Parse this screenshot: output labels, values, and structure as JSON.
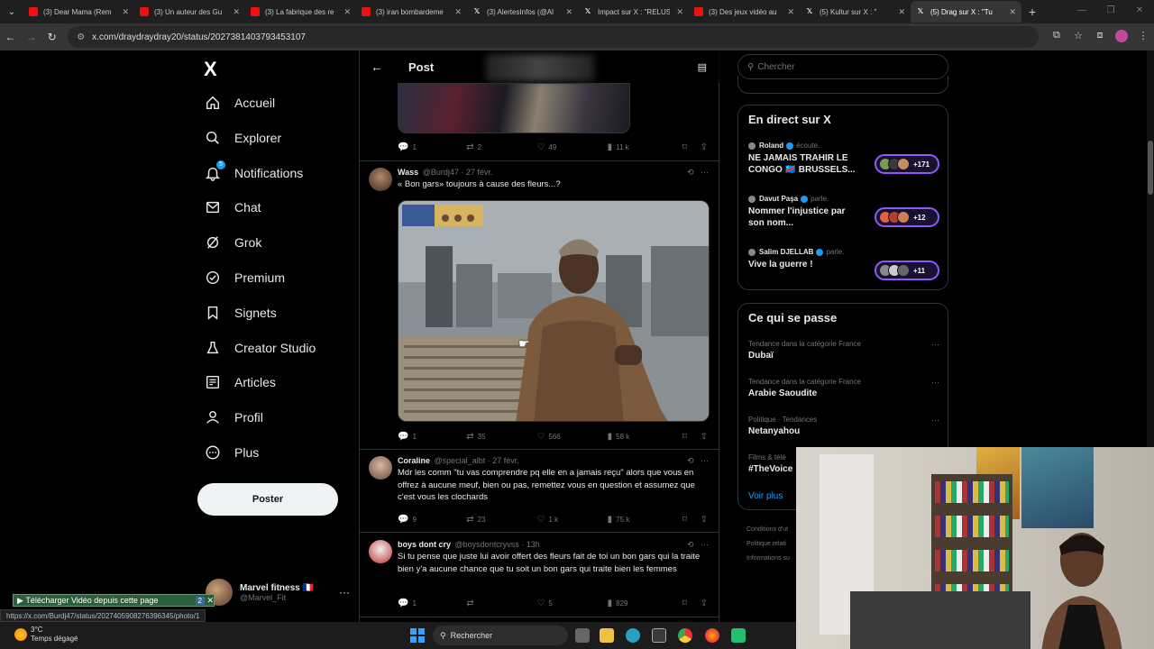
{
  "browser": {
    "tabs": [
      {
        "title": "(3) Dear Mama (Rem",
        "type": "yt"
      },
      {
        "title": "(3) Un auteur des Gu",
        "type": "yt"
      },
      {
        "title": "(3) La fabrique des re",
        "type": "yt"
      },
      {
        "title": "(3) iran bombardeme",
        "type": "yt"
      },
      {
        "title": "(3) AlertesInfos (@Al",
        "type": "x"
      },
      {
        "title": "Impact sur X : \"RELUS",
        "type": "x"
      },
      {
        "title": "(3) Des jeux vidéo au",
        "type": "yt"
      },
      {
        "title": "(5) Kultur sur X : \"",
        "type": "x"
      },
      {
        "title": "(5) Drag sur X : \"Tu",
        "type": "x"
      }
    ],
    "url": "x.com/draydraydray20/status/2027381403793453107",
    "status_url": "https://x.com/Burdj47/status/2027405908276396345/photo/1",
    "download_bar": "Télécharger Vidéo depuis cette page",
    "download_count": "2"
  },
  "sidebar": {
    "logo": "X",
    "items": [
      {
        "label": "Accueil",
        "icon": "home-icon"
      },
      {
        "label": "Explorer",
        "icon": "search-icon"
      },
      {
        "label": "Notifications",
        "icon": "bell-icon"
      },
      {
        "label": "Chat",
        "icon": "mail-icon"
      },
      {
        "label": "Grok",
        "icon": "grok-icon"
      },
      {
        "label": "Premium",
        "icon": "verified-icon"
      },
      {
        "label": "Signets",
        "icon": "bookmark-icon"
      },
      {
        "label": "Creator Studio",
        "icon": "flask-icon"
      },
      {
        "label": "Articles",
        "icon": "article-icon"
      },
      {
        "label": "Profil",
        "icon": "person-icon"
      },
      {
        "label": "Plus",
        "icon": "more-icon"
      }
    ],
    "notif_count": "5",
    "post_label": "Poster",
    "account": {
      "name": "Marvel fitness 🇫🇷",
      "handle": "@Marvel_Fit"
    }
  },
  "main": {
    "header_title": "Post",
    "prev_actions": {
      "replies": "1",
      "reposts": "2",
      "likes": "49",
      "views": "11 k"
    },
    "tweets": [
      {
        "name": "Wass",
        "handle": "@Burdj47",
        "date": "· 27 févr.",
        "text": "« Bon gars» toujours à cause des fleurs...?",
        "replies": "1",
        "reposts": "35",
        "likes": "566",
        "views": "58 k"
      },
      {
        "name": "Coraline",
        "handle": "@special_albt",
        "date": "· 27 févr.",
        "text": "Mdr les comm \"tu vas comprendre pq elle en a jamais reçu\" alors que vous en offrez à aucune meuf, bien ou pas, remettez vous en question et assumez que c'est vous les clochards",
        "replies": "9",
        "reposts": "23",
        "likes": "1 k",
        "views": "75 k"
      },
      {
        "name": "boys dont cry",
        "handle": "@boysdontcryvss",
        "date": "· 13h",
        "text": "Si tu pense que juste lui avoir offert des fleurs fait de toi un bon gars qui la traite bien y'a aucune chance que tu soit un bon gars qui traite bien les femmes",
        "replies": "1",
        "reposts": "",
        "likes": "5",
        "views": "829"
      }
    ]
  },
  "right": {
    "search_placeholder": "Chercher",
    "live_title": "En direct sur X",
    "live": [
      {
        "host": "Roland",
        "verb": "écoute.",
        "topic": "NE JAMAIS TRAHIR LE CONGO 🇨🇩 BRUSSELS...",
        "count": "+171"
      },
      {
        "host": "Davut Paşa",
        "verb": "parle.",
        "topic": "Nommer l'injustice par son nom...",
        "count": "+12"
      },
      {
        "host": "Salim DJELLAB",
        "verb": "parle.",
        "topic": "Vive la guerre !",
        "count": "+11"
      }
    ],
    "trends_title": "Ce qui se passe",
    "trends": [
      {
        "category": "Tendance dans la catégorie France",
        "name": "Dubaï"
      },
      {
        "category": "Tendance dans la catégorie France",
        "name": "Arabie Saoudite"
      },
      {
        "category": "Politique · Tendances",
        "name": "Netanyahou"
      },
      {
        "category": "Films & télé",
        "name": "#TheVoice"
      }
    ],
    "see_more": "Voir plus",
    "footer": [
      "Conditions d'ut",
      "Politique relati",
      "Informations su"
    ]
  },
  "taskbar": {
    "temp": "3°C",
    "weather": "Temps dégagé",
    "search": "Rechercher"
  }
}
